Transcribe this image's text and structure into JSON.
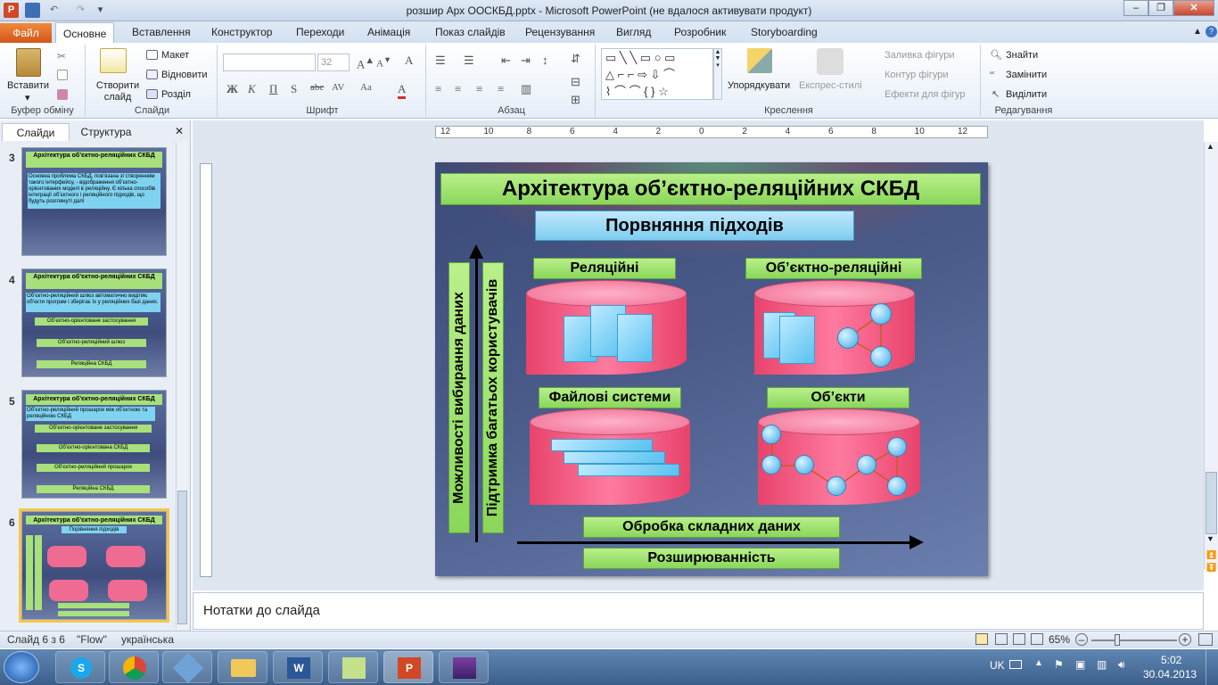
{
  "app": {
    "title": "розшир Арх ООСКБД.pptx - Microsoft PowerPoint (не вдалося активувати продукт)"
  },
  "tabs": {
    "file": "Файл",
    "items": [
      "Основне",
      "Вставлення",
      "Конструктор",
      "Переходи",
      "Анімація",
      "Показ слайдів",
      "Рецензування",
      "Вигляд",
      "Розробник",
      "Storyboarding"
    ]
  },
  "ribbon": {
    "clipboard": {
      "paste": "Вставити",
      "label": "Буфер обміну"
    },
    "slides": {
      "new_slide": "Створити слайд",
      "layout": "Макет",
      "reset": "Відновити",
      "section": "Розділ",
      "label": "Слайди"
    },
    "font": {
      "size": "32",
      "label": "Шрифт"
    },
    "paragraph": {
      "label": "Абзац"
    },
    "drawing": {
      "arrange": "Упорядкувати",
      "quick_styles": "Експрес-стилі",
      "fill": "Заливка фігури",
      "outline": "Контур фігури",
      "effects": "Ефекти для фігур",
      "label": "Креслення"
    },
    "editing": {
      "find": "Знайти",
      "replace": "Замінити",
      "select": "Виділити",
      "label": "Редагування"
    }
  },
  "leftpane": {
    "tab_slides": "Слайди",
    "tab_outline": "Структура",
    "thumbs": [
      {
        "num": "3",
        "title": "Архітектура об’єктно-реляційних СКБД",
        "text": "Основна проблема СКБД, пов’язана зі створенням такого інтерфейсу, - відображення об’єктно-орієнтованих моделі в реляційну. Є кілька способів інтеграції об’єктного і реляційного підходів, що будуть розглянуті далі"
      },
      {
        "num": "4",
        "title": "Архітектура об’єктно-реляційних СКБД",
        "text": "Об’єктно-реляційний шлюз автоматично виділяє об’єкти програм і зберігає їх у реляційних базі даних.",
        "b1": "Об’єктно-орієнтоване застосування",
        "b2": "Об’єктно-реляційний шлюз",
        "b3": "Реляційна СКБД"
      },
      {
        "num": "5",
        "title": "Архітектура об’єктно-реляційних СКБД",
        "text": "Об’єктно-реляційний прошарок між об’єктною та реляційною СКБД",
        "b1": "Об’єктно-орієнтоване застосування",
        "b2": "Об’єктно-орієнтована СКБД",
        "b3": "Об’єктно-реляційний прошарок",
        "b4": "Реляційна СКБД"
      },
      {
        "num": "6",
        "title": "Архітектура об’єктно-реляційних СКБД",
        "sub": "Порівняння підходів"
      }
    ]
  },
  "slide": {
    "title": "Архітектура об’єктно-реляційних СКБД",
    "subtitle": "Порвняння підходів",
    "relational": "Реляційні",
    "objrel": "Об’єктно-реляційні",
    "files": "Файлові системи",
    "objects": "Об’єкти",
    "vlabel1": "Можливості вибирання даних",
    "vlabel2": "Підтримка багатьох користувачів",
    "hlabel1": "Обробка складних даних",
    "hlabel2": "Розширюванність"
  },
  "ruler": {
    "ticks": [
      "12",
      "10",
      "8",
      "6",
      "4",
      "2",
      "0",
      "2",
      "4",
      "6",
      "8",
      "10",
      "12"
    ]
  },
  "notes": {
    "placeholder": "Нотатки до слайда"
  },
  "status": {
    "slide": "Слайд 6 з 6",
    "theme": "\"Flow\"",
    "lang": "українська",
    "zoom": "65%"
  },
  "taskbar": {
    "lang": "UK",
    "time": "5:02",
    "date": "30.04.2013"
  }
}
